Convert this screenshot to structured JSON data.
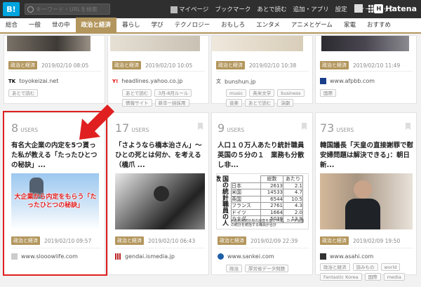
{
  "topbar": {
    "logo": "B!",
    "search_placeholder": "キーワード・URLを検索",
    "nav": [
      "マイページ",
      "ブックマーク",
      "あとで読む",
      "追加・アプリ",
      "設定",
      "フィードバック"
    ],
    "brand": "Hatena"
  },
  "categories": [
    {
      "label": "総合",
      "active": false
    },
    {
      "label": "一般",
      "active": false
    },
    {
      "label": "世の中",
      "active": false
    },
    {
      "label": "政治と経済",
      "active": true
    },
    {
      "label": "暮らし",
      "active": false
    },
    {
      "label": "学び",
      "active": false
    },
    {
      "label": "テクノロジー",
      "active": false
    },
    {
      "label": "おもしろ",
      "active": false
    },
    {
      "label": "エンタメ",
      "active": false
    },
    {
      "label": "アニメとゲーム",
      "active": false
    },
    {
      "label": "家電",
      "active": false
    },
    {
      "label": "おすすめ",
      "active": false
    }
  ],
  "top_row": [
    {
      "badge": "政治と経済",
      "date": "2019/02/10 08:05",
      "source": "toyokeizai.net",
      "favicon": "TK",
      "tags": [
        "あとで読む"
      ]
    },
    {
      "badge": "政治と経済",
      "date": "2019/02/10 10:05",
      "source": "headlines.yahoo.co.jp",
      "favicon": "Y!",
      "tags": [
        "あとで読む",
        "3月-8月ルール",
        "情報サイト",
        "新卒一括採用"
      ]
    },
    {
      "badge": "政治と経済",
      "date": "2019/02/10 10:38",
      "source": "bunshun.jp",
      "favicon": "文",
      "tags": [
        "music",
        "英米文学",
        "business",
        "音楽",
        "あとで読む",
        "演劇"
      ]
    },
    {
      "badge": "政治と経済",
      "date": "2019/02/10 11:49",
      "source": "www.afpbb.com",
      "favicon": "AFP",
      "tags": [
        "国際"
      ]
    }
  ],
  "cards": [
    {
      "count": "8",
      "users_label": "USERS",
      "title": "有名大企業の内定を5つ貰った私が教える「たったひとつの秘訣」...",
      "thumb_text": "大企業から内定をもらう「たったひとつの秘訣」",
      "badge": "政治と経済",
      "date": "2019/02/10 09:57",
      "source": "www.slooowlife.com",
      "tags": []
    },
    {
      "count": "17",
      "users_label": "USERS",
      "title": "「さようなら橋本治さん」～ひとの死とは何か、を考える（橋爪 ...",
      "badge": "政治と経済",
      "date": "2019/02/10 06:43",
      "source": "gendai.ismedia.jp",
      "tags": []
    },
    {
      "count": "9",
      "users_label": "USERS",
      "title": "人口１０万人あたり統計職員　英国の５分の１　業務も分散し非...",
      "badge": "政治と経済",
      "date": "2019/02/09 22:39",
      "source": "www.sankei.com",
      "tags": [
        "政治",
        "厚労省データ問題"
      ],
      "table": {
        "headers": [
          "",
          "総数",
          "あたり"
        ],
        "side": "国の統計職員の人数",
        "rows": [
          [
            "日本",
            "2613",
            "2.1"
          ],
          [
            "米国",
            "14533",
            "4.7"
          ],
          [
            "英国",
            "6544",
            "10.5"
          ],
          [
            "フランス",
            "2761",
            "4.3"
          ],
          [
            "ドイツ",
            "1664",
            "2.0"
          ],
          [
            "カナダ",
            "5039",
            "13.9"
          ]
        ],
        "note": "※総務省統計局の調査を基に作成。カナダは国の統計を統括する職員が合計"
      }
    },
    {
      "count": "73",
      "users_label": "USERS",
      "title": "韓国議長「天皇の直接謝罪で慰安婦問題は解決できる」：朝日新...",
      "badge": "政治と経済",
      "date": "2019/02/09 19:50",
      "source": "www.asahi.com",
      "tags": [
        "政治と経済",
        "読みもの",
        "world",
        "Fantastic Korea",
        "国際",
        "media"
      ]
    }
  ]
}
